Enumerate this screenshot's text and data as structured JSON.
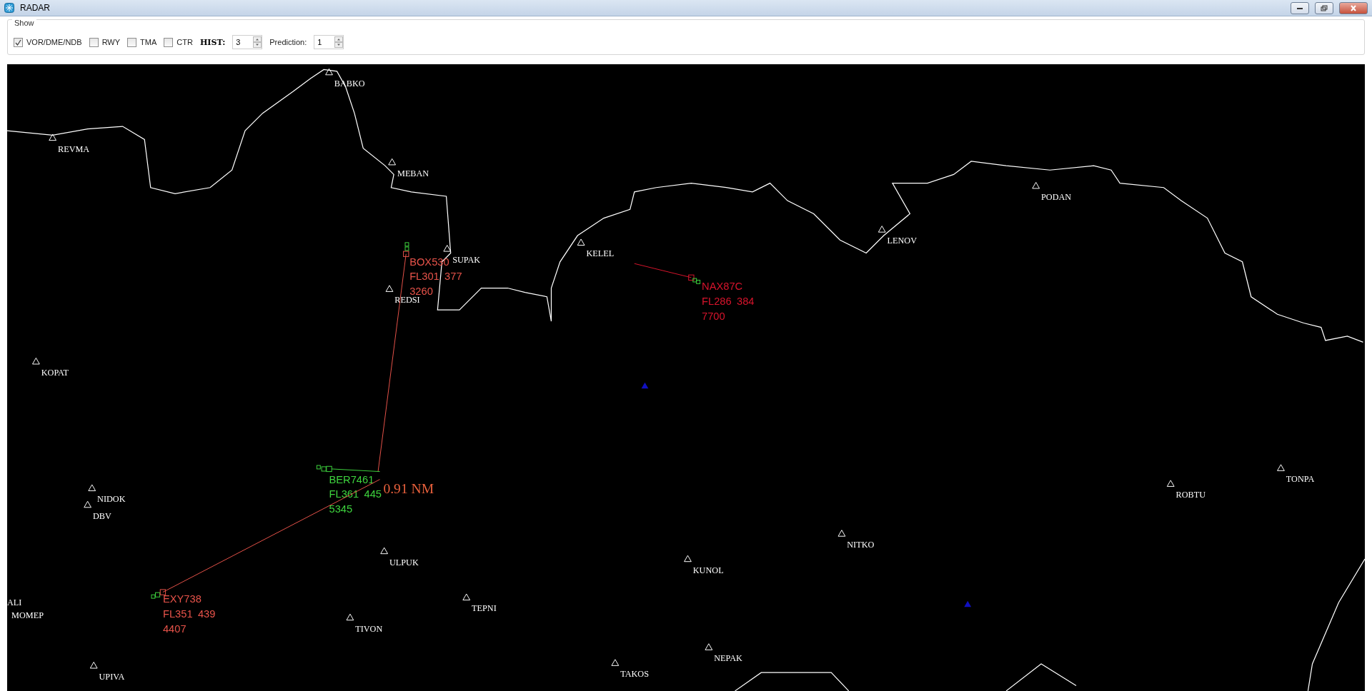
{
  "window": {
    "title": "RADAR"
  },
  "show_panel": {
    "title": "Show",
    "options": [
      {
        "label": "VOR/DME/NDB",
        "checked": true
      },
      {
        "label": "RWY",
        "checked": false
      },
      {
        "label": "TMA",
        "checked": false
      },
      {
        "label": "CTR",
        "checked": false
      }
    ],
    "hist": {
      "label": "HIST:",
      "value": "3"
    },
    "prediction": {
      "label": "Prediction:",
      "value": "1"
    }
  },
  "map": {
    "waypoints": [
      {
        "name": "BABKO"
      },
      {
        "name": "REVMA"
      },
      {
        "name": "MEBAN"
      },
      {
        "name": "SUPAK"
      },
      {
        "name": "REDSI"
      },
      {
        "name": "KELEL"
      },
      {
        "name": "LENOV"
      },
      {
        "name": "PODAN"
      },
      {
        "name": "KOPAT"
      },
      {
        "name": "NIDOK"
      },
      {
        "name": "DBV"
      },
      {
        "name": "ROBTU"
      },
      {
        "name": "TONPA"
      },
      {
        "name": "NITKO"
      },
      {
        "name": "KUNOL"
      },
      {
        "name": "ULPUK"
      },
      {
        "name": "TEPNI"
      },
      {
        "name": "TIVON"
      },
      {
        "name": "ALI"
      },
      {
        "name": "MOMEP"
      },
      {
        "name": "UPIVA"
      },
      {
        "name": "TAKOS"
      },
      {
        "name": "NEPAK"
      }
    ],
    "aircraft": [
      {
        "callsign": "BOX530",
        "flight_level": "FL301",
        "speed": "377",
        "squawk": "3260",
        "color": "#e8534a"
      },
      {
        "callsign": "NAX87C",
        "flight_level": "FL286",
        "speed": "384",
        "squawk": "7700",
        "color": "#d8142c"
      },
      {
        "callsign": "BER7461",
        "flight_level": "FL361",
        "speed": "445",
        "squawk": "5345",
        "color": "#3ed43e"
      },
      {
        "callsign": "EXY738",
        "flight_level": "FL351",
        "speed": "439",
        "squawk": "4407",
        "color": "#e8534a"
      }
    ],
    "distance": {
      "label": "0.91 NM"
    }
  }
}
